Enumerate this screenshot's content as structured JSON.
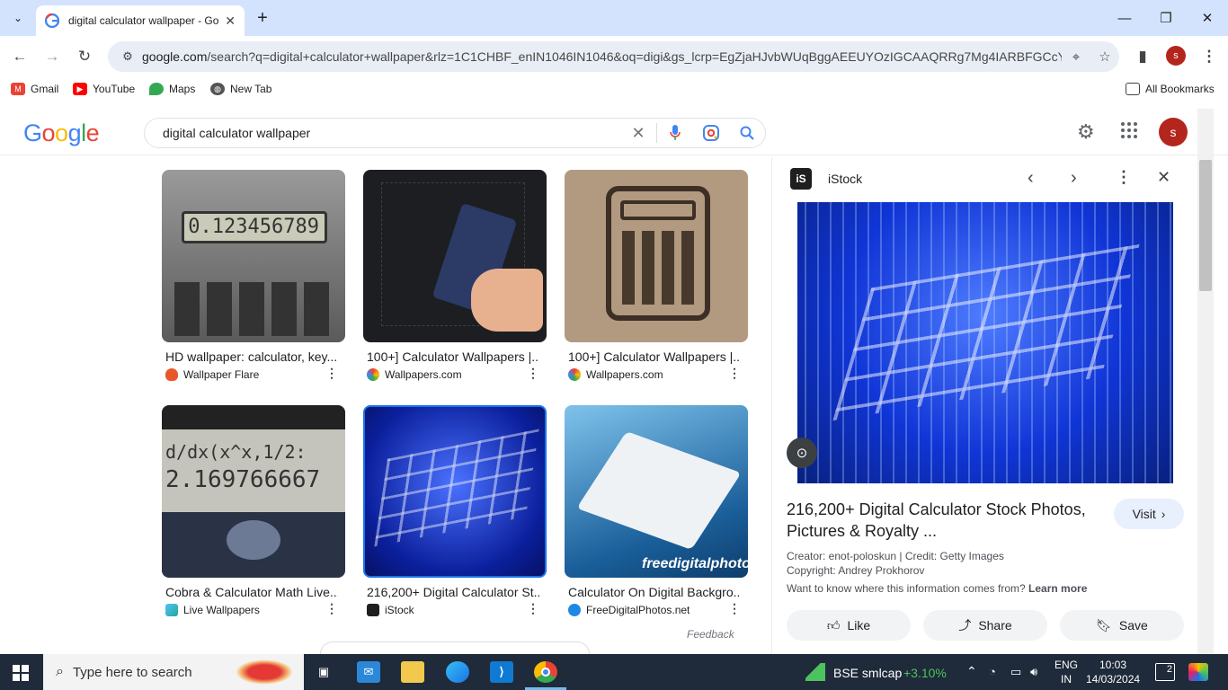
{
  "browser": {
    "tab_title": "digital calculator wallpaper - Go",
    "url_host": "google.com",
    "url_rest": "/search?q=digital+calculator+wallpaper&rlz=1C1CHBF_enIN1046IN1046&oq=digi&gs_lcrp=EgZjaHJvbWUqBggAEEUYOzIGCAAQRRg7Mg4IARBFGCcY...",
    "profile_initial": "s"
  },
  "bookmarks": {
    "items": [
      "Gmail",
      "YouTube",
      "Maps",
      "New Tab"
    ],
    "all_bookmarks": "All Bookmarks"
  },
  "google": {
    "logo": "Google",
    "query": "digital calculator wallpaper",
    "avatar_initial": "s"
  },
  "results": [
    {
      "title": "HD wallpaper: calculator, key...",
      "source": "Wallpaper Flare",
      "display": "0.123456789"
    },
    {
      "title": "100+] Calculator Wallpapers |...",
      "source": "Wallpapers.com"
    },
    {
      "title": "100+] Calculator Wallpapers |...",
      "source": "Wallpapers.com"
    },
    {
      "title": "Cobra & Calculator Math Live...",
      "source": "Live Wallpapers",
      "display_top": "d/dx(x^x,1/2:",
      "display_bottom": "2.169766667"
    },
    {
      "title": "216,200+ Digital Calculator St...",
      "source": "iStock"
    },
    {
      "title": "Calculator On Digital Backgro...",
      "source": "FreeDigitalPhotos.net",
      "watermark": "freedigitalphoto"
    }
  ],
  "feedback": "Feedback",
  "panel": {
    "source": "iStock",
    "title": "216,200+ Digital Calculator Stock Photos, Pictures & Royalty ...",
    "visit": "Visit",
    "creator": "Creator: enot-poloskun | Credit: Getty Images",
    "copyright": "Copyright: Andrey Prokhorov",
    "info_question": "Want to know where this information comes from?",
    "learn_more": "Learn more",
    "like": "Like",
    "share": "Share",
    "save": "Save"
  },
  "taskbar": {
    "search_placeholder": "Type here to search",
    "stock_name": "BSE smlcap",
    "stock_change": "+3.10%",
    "lang_top": "ENG",
    "lang_bottom": "IN",
    "time": "10:03",
    "date": "14/03/2024",
    "notifications": "2"
  },
  "colors": {
    "accent_blue": "#1a73e8",
    "titlebar": "#d3e3fd",
    "taskbar": "#1f2a3a",
    "stock_green": "#4cc35e"
  }
}
